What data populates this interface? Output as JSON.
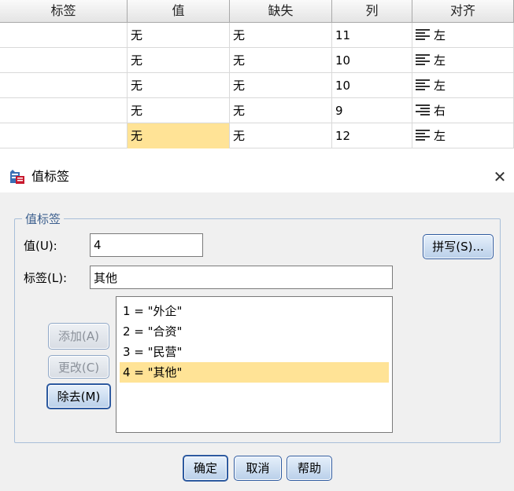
{
  "grid": {
    "columns": [
      "标签",
      "值",
      "缺失",
      "列",
      "对齐"
    ],
    "rows": [
      {
        "label": "",
        "value": "无",
        "missing": "无",
        "column": "11",
        "align": "左",
        "align_icon": "align-left-icon"
      },
      {
        "label": "",
        "value": "无",
        "missing": "无",
        "column": "10",
        "align": "左",
        "align_icon": "align-left-icon"
      },
      {
        "label": "",
        "value": "无",
        "missing": "无",
        "column": "10",
        "align": "左",
        "align_icon": "align-left-icon"
      },
      {
        "label": "",
        "value": "无",
        "missing": "无",
        "column": "9",
        "align": "右",
        "align_icon": "align-right-icon"
      },
      {
        "label": "",
        "value": "无",
        "missing": "无",
        "column": "12",
        "align": "左",
        "align_icon": "align-left-icon"
      }
    ]
  },
  "dialog": {
    "title": "值标签",
    "close_symbol": "✕",
    "group_label": "值标签",
    "value_label": "值(U):",
    "value_input": "4",
    "label_label": "标签(L):",
    "label_input": "其他",
    "spell_button": "拼写(S)...",
    "add_button": "添加(A)",
    "change_button": "更改(C)",
    "remove_button": "除去(M)",
    "list": [
      "1 = \"外企\"",
      "2 = \"合资\"",
      "3 = \"民营\"",
      "4 = \"其他\""
    ],
    "selected_index": 3,
    "ok_button": "确定",
    "cancel_button": "取消",
    "help_button": "帮助"
  },
  "colors": {
    "selection": "#ffe396",
    "button_border": "#2d5aa0",
    "group_border": "#a8bfd9"
  }
}
